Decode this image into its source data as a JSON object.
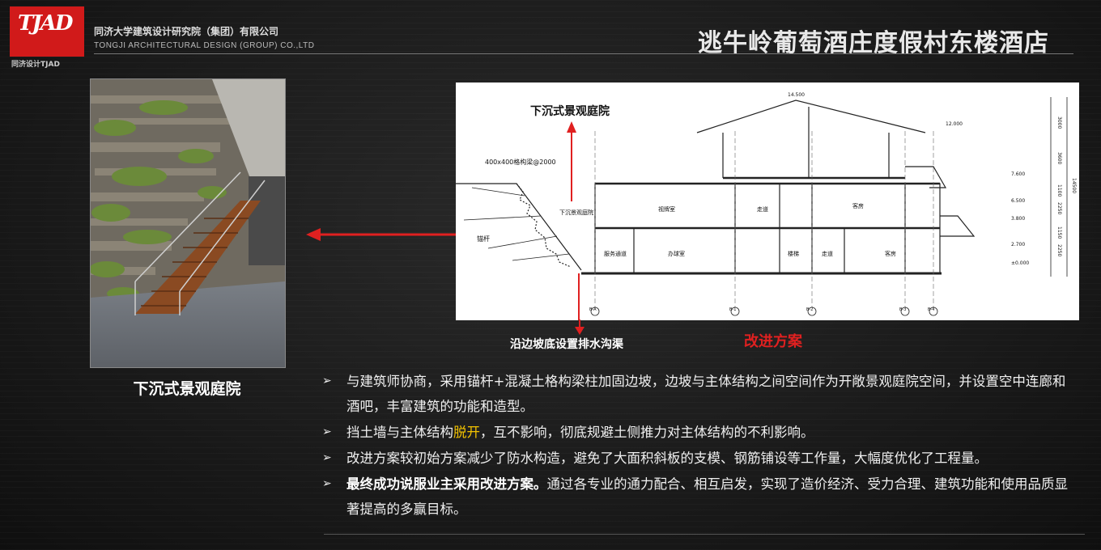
{
  "header": {
    "logo_text": "TJAD",
    "logo_sub": "同济设计TJAD",
    "company_cn": "同济大学建筑设计研究院（集团）有限公司",
    "company_en": "TONGJI ARCHITECTURAL DESIGN (GROUP) CO.,LTD",
    "title": "逃牛岭葡萄酒庄度假村东楼酒店"
  },
  "photo": {
    "caption": "下沉式景观庭院"
  },
  "drawing": {
    "sunken_label": "下沉式景观庭院",
    "drain_label": "沿边坡底设置排水沟渠",
    "improved_label": "改进方案",
    "beam_note": "400x400格构梁@2000",
    "anchor_note": "锚杆",
    "room_labels": [
      "下沉景观庭院",
      "视牌室",
      "走道",
      "客房",
      "服务通道",
      "办球室",
      "楼梯",
      "走道",
      "客房"
    ],
    "elevations": [
      "14.500",
      "12.000",
      "7.600",
      "6.500",
      "3.800",
      "2.700",
      "±0.000"
    ],
    "dims": [
      "3000",
      "3600",
      "1100",
      "2250",
      "1150",
      "2250",
      "14500"
    ],
    "grid_marks": [
      "B-A",
      "B-1",
      "B-2",
      "B-3",
      "B-4"
    ]
  },
  "bullets": [
    {
      "parts": [
        {
          "t": "与建筑师协商，采用锚杆+混凝土格构梁柱加固边坡，边坡与主体结构之间空间作为开敞景观庭院空间，并设置空中连廊和酒吧，丰富建筑的功能和造型。",
          "s": "normal"
        }
      ]
    },
    {
      "parts": [
        {
          "t": "挡土墙与主体结构",
          "s": "normal"
        },
        {
          "t": "脱开",
          "s": "highlight"
        },
        {
          "t": "，互不影响，彻底规避土侧推力对主体结构的不利影响。",
          "s": "normal"
        }
      ]
    },
    {
      "parts": [
        {
          "t": "改进方案较初始方案减少了防水构造，避免了大面积斜板的支模、钢筋铺设等工作量，大幅度优化了工程量。",
          "s": "normal"
        }
      ]
    },
    {
      "parts": [
        {
          "t": "最终成功说服业主采用改进方案。",
          "s": "bold"
        },
        {
          "t": "通过各专业的通力配合、相互启发，实现了造价经济、受力合理、建筑功能和使用品质显著提高的多赢目标。",
          "s": "normal"
        }
      ]
    }
  ],
  "colors": {
    "logo_red": "#d11a1a",
    "arrow_red": "#e02020",
    "highlight": "#f2c200"
  }
}
